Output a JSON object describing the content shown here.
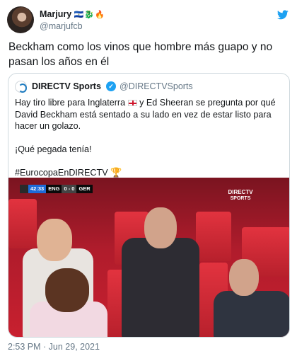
{
  "tweet": {
    "author_name": "Marjury",
    "author_emoji": "🇸🇻🐉🔥",
    "author_handle": "@marjufcb",
    "text": "Beckham como los vinos que hombre más guapo y no pasan los años en él",
    "timestamp": "2:53 PM · Jun 29, 2021"
  },
  "quoted_tweet": {
    "author_name": "DIRECTV Sports",
    "author_handle": "@DIRECTVSports",
    "line1_a": "Hay tiro libre para Inglaterra",
    "line1_b": " y Ed Sheeran se pregunta por qué David Beckham está sentado a su lado en vez de estar listo para hacer un golazo.",
    "line2": "¡Qué pegada tenía!",
    "line3": "#EurocopaEnDIRECTV",
    "emojis": {
      "flag": "england-flag",
      "trophy": "trophy"
    },
    "media": {
      "scoreboard": {
        "clock": "42:33",
        "home": "ENG",
        "score": "0 - 0",
        "away": "GER"
      },
      "brand_line1": "DIRECTV",
      "brand_line2": "SPORTS"
    }
  },
  "icons": {
    "app": "twitter-bird-icon",
    "verified": "verified-badge-icon"
  },
  "colors": {
    "twitter_blue": "#1da1f2",
    "secondary_text": "#657786",
    "border": "#cfd9de"
  }
}
